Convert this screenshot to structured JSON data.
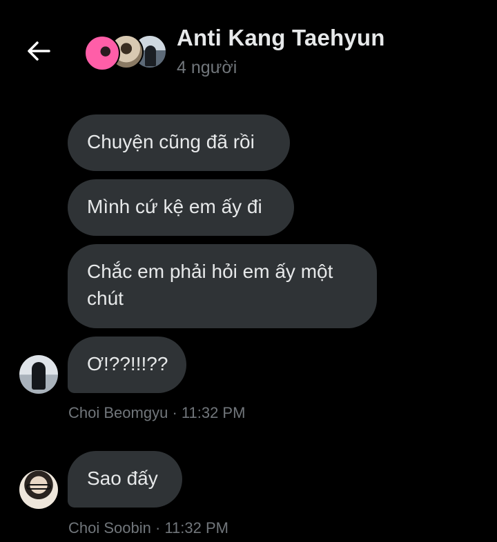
{
  "header": {
    "title": "Anti Kang Taehyun",
    "member_count": "4 người",
    "back_icon": "arrow-left-icon",
    "back_color": "#ffffff"
  },
  "colors": {
    "background": "#000000",
    "bubble": "#2f3336",
    "text": "#e7e9ea",
    "muted": "#71767b"
  },
  "messages": [
    {
      "text": "Chuyện cũng đã rồi"
    },
    {
      "text": "Mình cứ kệ em ấy đi"
    },
    {
      "text": "Chắc em phải hỏi em ấy một chút"
    },
    {
      "text": "Ơ!??!!!??",
      "sender": "Choi Beomgyu",
      "separator": "·",
      "time": "11:32 PM"
    },
    {
      "text": "Sao đấy",
      "sender": "Choi Soobin",
      "separator": "·",
      "time": "11:32 PM"
    }
  ]
}
